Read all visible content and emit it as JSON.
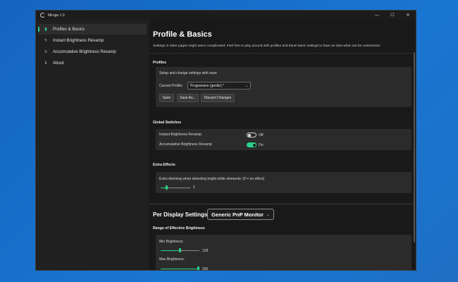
{
  "window": {
    "title": "Mirage 1.0"
  },
  "controls": {
    "minimize": "—",
    "maximize": "☐",
    "close": "✕"
  },
  "sidebar": {
    "items": [
      {
        "label": "Profiles & Basics",
        "icon": "bookmark-icon",
        "glyph": "▮",
        "active": true
      },
      {
        "label": "Instant Brightness Revamp",
        "icon": "bolt-icon",
        "glyph": "ϟ",
        "active": false
      },
      {
        "label": "Accumulative Brightness Revamp",
        "icon": "layers-icon",
        "glyph": "≡",
        "active": false
      },
      {
        "label": "About",
        "icon": "info-icon",
        "glyph": "ℹ",
        "active": false
      }
    ]
  },
  "page": {
    "title": "Profile & Basics",
    "description": "Settings in other pages might seem complicated. Feel free to play around with profiles and these basic settings to have an idea what can be customized."
  },
  "profiles": {
    "section_title": "Profiles",
    "subtitle": "Setup and change settings with ease",
    "current_label": "Current Profile:",
    "current_value": "Progressive (gentle) *",
    "save": "Save",
    "save_as": "Save As...",
    "discard": "Discard Changes"
  },
  "global_switches": {
    "section_title": "Global Switches",
    "instant_label": "Instant Brightness Revamp",
    "instant_state": "Off",
    "accumulative_label": "Accumulative Brightness Revamp",
    "accumulative_state": "On"
  },
  "extra_effects": {
    "section_title": "Extra Effects",
    "dimming_label": "Extra dimming when detecting bright white elements: (0 = no effect)",
    "dimming_value": "2",
    "dimming_fraction": 0.2
  },
  "per_display": {
    "label": "Per Display Settings:",
    "monitor": "Generic PnP Monitor"
  },
  "range": {
    "section_title": "Range of Effective Brightness",
    "min_label": "Min Brightness:",
    "min_value": "128",
    "min_fraction": 0.5,
    "max_label": "Max Brightness:",
    "max_value": "255",
    "max_fraction": 1.0
  },
  "colors": {
    "accent": "#2bd18b",
    "desktop": "#1565c0"
  }
}
